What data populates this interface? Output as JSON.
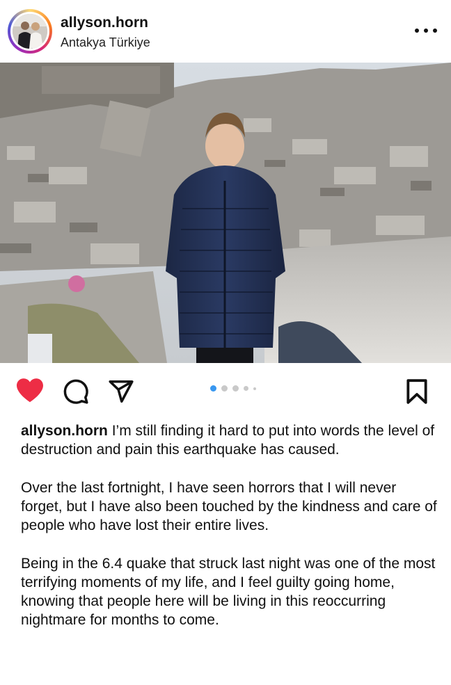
{
  "post": {
    "username": "allyson.horn",
    "location": "Antakya Türkiye"
  },
  "icons": {
    "more": "more-dots-icon",
    "like": "heart-filled-icon",
    "comment": "comment-bubble-icon",
    "share": "paper-plane-icon",
    "save": "bookmark-icon"
  },
  "colors": {
    "like_active": "#ed2d45",
    "carousel_active": "#3897f0"
  },
  "carousel": {
    "total_dots": 5,
    "active_index": 0
  },
  "caption": {
    "username": "allyson.horn",
    "paragraph_1": "I’m still finding it hard to put into words the level of destruction and pain this earthquake has caused.",
    "paragraph_2": "Over the last fortnight, I have seen horrors that I will never forget, but I have also been touched by the kindness and care of people who have lost their entire lives.",
    "paragraph_3": "Being in the 6.4 quake that struck last night was one of the most terrifying moments of my life, and I feel guilty going home, knowing that people here will be living in this reoccurring nightmare for months to come."
  }
}
